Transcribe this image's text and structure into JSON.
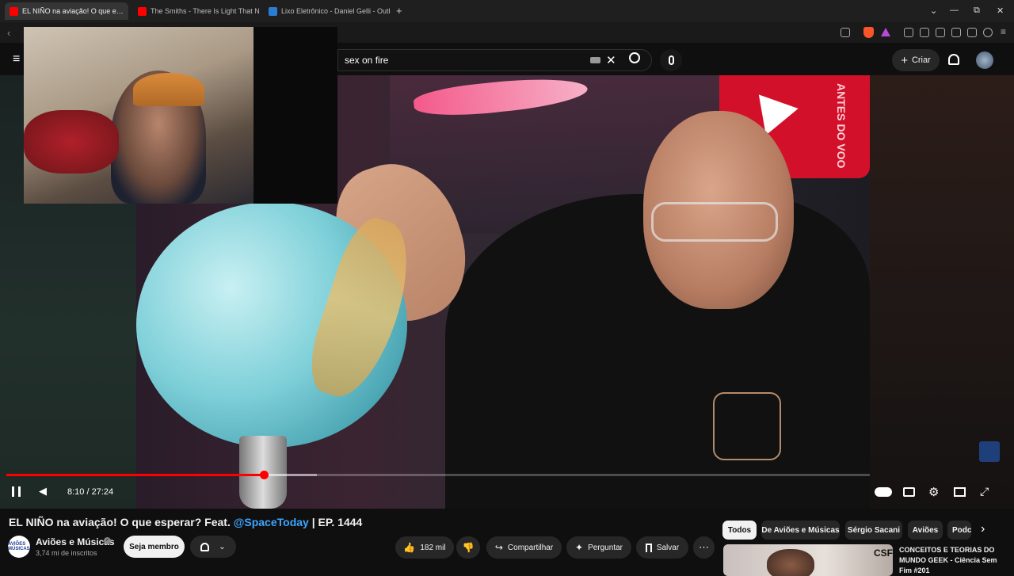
{
  "browser": {
    "tabs": [
      {
        "label": "EL NIÑO na aviação! O que e…",
        "active": true,
        "favicon_color": "#ff0000"
      },
      {
        "label": "The Smiths - There Is Light That Nev…",
        "active": false,
        "favicon_color": "#ff0000"
      },
      {
        "label": "Lixo Eletrônico - Daniel Gelli - Outlo…",
        "active": false,
        "favicon_color": "#2b7cd3"
      }
    ],
    "new_tab_label": "+",
    "tab_close_label": "✕",
    "window_controls": [
      "⌄",
      "—",
      "⧉",
      "✕"
    ]
  },
  "header": {
    "search_value": "sex on fire",
    "create_label": "Criar"
  },
  "player": {
    "time_text": "8:10 / 27:24",
    "progress": 0.2985,
    "buffered": 0.36,
    "overlay_text": "ANTES DO VOO"
  },
  "video": {
    "title_prefix": "EL NIÑO na aviação! O que esperar? Feat. ",
    "title_mention": "@SpaceToday",
    "title_suffix": " | EP. 1444",
    "channel_name": "Aviões e Músicas",
    "channel_avatar_text": "AVIÕES MÚSICAS",
    "subscribers": "3,74 mi de inscritos",
    "join_label": "Seja membro",
    "likes": "182 mil",
    "share_label": "Compartilhar",
    "ask_label": "Perguntar",
    "save_label": "Salvar"
  },
  "chips": [
    {
      "label": "Todos",
      "selected": true
    },
    {
      "label": "De Aviões e Músicas",
      "selected": false
    },
    {
      "label": "Sérgio Sacani",
      "selected": false
    },
    {
      "label": "Aviões",
      "selected": false
    },
    {
      "label": "Podc",
      "selected": false
    }
  ],
  "recommendation": {
    "title": "CONCEITOS E TEORIAS DO MUNDO GEEK - Ciência Sem Fim #201",
    "thumb_badge": "CSF"
  },
  "colors": {
    "accent": "#ff0000",
    "link": "#3ea6ff",
    "bg": "#0f0f0f"
  }
}
